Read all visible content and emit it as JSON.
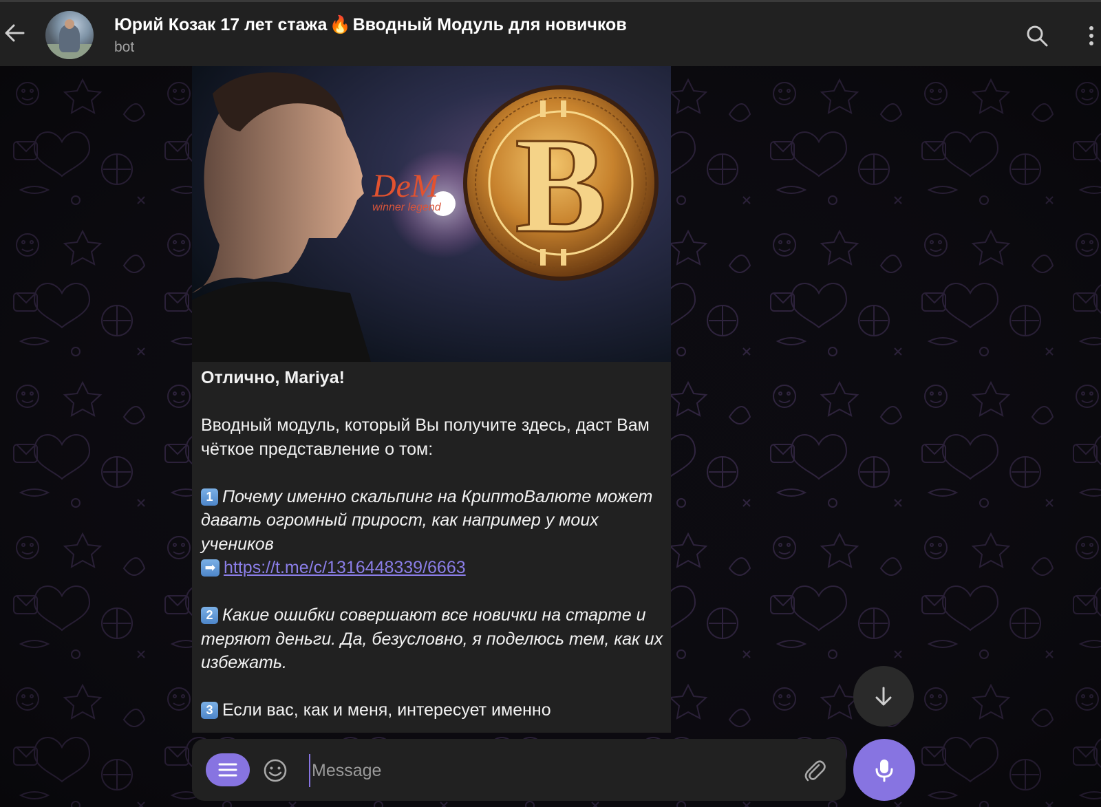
{
  "header": {
    "title": "Юрий Козак 17 лет стажа 🔥 Вводный Модуль для новичков",
    "title_part1": "Юрий Козак 17 лет стажа",
    "title_emoji": "🔥",
    "title_part2": "Вводный Модуль для новичков",
    "subtitle": "bot",
    "icons": {
      "back": "arrow-left-icon",
      "search": "search-icon",
      "more": "more-vertical-icon"
    }
  },
  "message": {
    "image": {
      "logo_text": "DeM",
      "logo_subtext": "winner legend"
    },
    "greeting": "Отлично, Mariya!",
    "intro": "Вводный модуль, который Вы получите здесь, даст Вам чёткое представление о том:",
    "items": [
      {
        "number": "1",
        "text": "Почему именно скальпинг на КриптоВалюте может давать огромный прирост, как например у моих учеников",
        "link_icon": "➡",
        "link": "https://t.me/c/1316448339/6663"
      },
      {
        "number": "2",
        "text": "Какие ошибки совершают все новички на старте и теряют деньги. Да, безусловно, я поделюсь тем, как их избежать."
      },
      {
        "number": "3",
        "text": "Если вас, как и меня, интересует именно"
      }
    ]
  },
  "composer": {
    "placeholder": "Message",
    "icons": {
      "menu": "menu-icon",
      "emoji": "emoji-icon",
      "attach": "paperclip-icon",
      "mic": "microphone-icon"
    }
  },
  "scroll_down_icon": "arrow-down-icon",
  "colors": {
    "accent": "#8774e1",
    "link": "#8b7ee8",
    "topbar": "#212121",
    "bubble": "#212121",
    "background": "#0c0b10"
  }
}
